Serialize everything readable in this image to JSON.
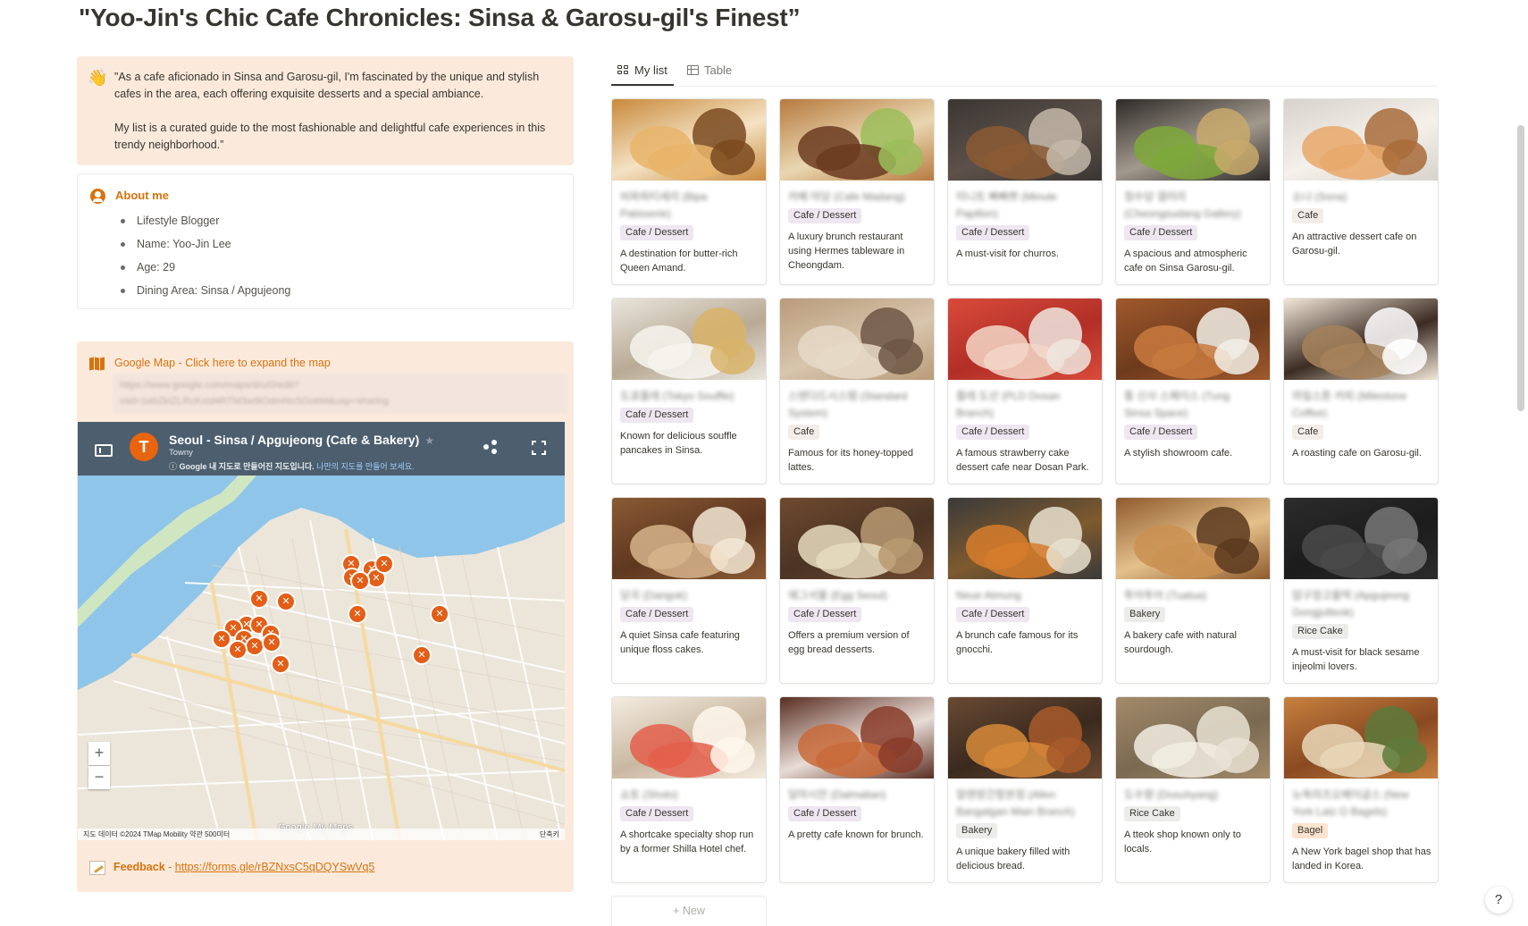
{
  "title": "\"Yoo-Jin's Chic Cafe Chronicles: Sinsa & Garosu-gil's Finest”",
  "intro": {
    "icon": "waving-hand-icon",
    "paragraph1": "\"As a cafe aficionado in Sinsa and Garosu-gil, I'm fascinated by the unique and stylish cafes in the area, each offering exquisite desserts and a special ambiance.",
    "paragraph2": "My list is a curated guide to the most fashionable and delightful cafe experiences in this trendy neighborhood.”"
  },
  "about": {
    "icon": "person-icon",
    "heading": "About me",
    "items": [
      "Lifestyle Blogger",
      "Name: Yoo-Jin Lee",
      "Age: 29",
      "Dining Area: Sinsa / Apgujeong"
    ]
  },
  "map_callout": {
    "icon": "map-icon",
    "heading": "Google Map - Click here to expand the map",
    "blurred_link": "https://www.google.com/maps/d/u/0/edit?mid=1ebZkIZLRzKxId4RTM3w9tOdmNxSGo6M&usp=sharing",
    "embed": {
      "title": "Seoul - Sinsa / Apgujeong (Cafe & Bakery)",
      "subtitle": "Towny",
      "notice": "Google 내 지도로 만들어진 지도입니다.",
      "notice_link": "나만의 지도를 만들어 보세요.",
      "logo_letter": "T",
      "google_logo": "Google",
      "my_maps": "My Maps",
      "attribution": "지도 데이터 ©2024 TMap Mobility   약관   500미터",
      "shortcut": "단축키",
      "zoom_in": "+",
      "zoom_out": "−"
    }
  },
  "feedback": {
    "icon": "memo-icon",
    "label": "Feedback",
    "separator": " - ",
    "link": "https://forms.gle/rBZNxsC5qDQYSwVq5"
  },
  "tabs": [
    {
      "label": "My list",
      "icon": "gallery-icon",
      "active": true
    },
    {
      "label": "Table",
      "icon": "table-icon",
      "active": false
    }
  ],
  "cards": [
    {
      "name": "비파파티세리 (Bipa Patisserie)",
      "tag": "Cafe / Dessert",
      "tag_color": "purple",
      "desc": "A destination for butter-rich Queen Amand."
    },
    {
      "name": "카페 마당 (Cafe Madang)",
      "tag": "Cafe / Dessert",
      "tag_color": "purple",
      "desc": "A luxury brunch restaurant using Hermes tableware in Cheongdam."
    },
    {
      "name": "미니트 빠빠쁘 (Minute Papillon)",
      "tag": "Cafe / Dessert",
      "tag_color": "purple",
      "desc": "A must-visit for churros."
    },
    {
      "name": "청수당 갤러리 (Cheongsudang Gallery)",
      "tag": "Cafe / Dessert",
      "tag_color": "purple",
      "desc": "A spacious and atmospheric cafe on Sinsa Garosu-gil."
    },
    {
      "name": "소나 (Sona)",
      "tag": "Cafe",
      "tag_color": "brown",
      "desc": "An attractive dessert cafe on Garosu-gil."
    },
    {
      "name": "도쿄플레 (Tokyo Souffle)",
      "tag": "Cafe / Dessert",
      "tag_color": "purple",
      "desc": "Known for delicious souffle pancakes in Sinsa."
    },
    {
      "name": "스탠다드시스템 (Standard System)",
      "tag": "Cafe",
      "tag_color": "brown",
      "desc": "Famous for its honey-topped lattes."
    },
    {
      "name": "플레 도산 (PLD Dosan Branch)",
      "tag": "Cafe / Dessert",
      "tag_color": "purple",
      "desc": "A famous strawberry cake dessert cafe near Dosan Park."
    },
    {
      "name": "퉁 신사 스페이스 (Tung Sinsa Space)",
      "tag": "Cafe / Dessert",
      "tag_color": "purple",
      "desc": "A stylish showroom cafe."
    },
    {
      "name": "마일스톤 커피 (Milestone Coffee)",
      "tag": "Cafe",
      "tag_color": "brown",
      "desc": "A roasting cafe on Garosu-gil."
    },
    {
      "name": "당곡 (Dangok)",
      "tag": "Cafe / Dessert",
      "tag_color": "purple",
      "desc": "A quiet Sinsa cafe featuring unique floss cakes."
    },
    {
      "name": "에그서울 (Egg Seoul)",
      "tag": "Cafe / Dessert",
      "tag_color": "purple",
      "desc": "Offers a premium version of egg bread desserts."
    },
    {
      "name": "Neue Atmung",
      "tag": "Cafe / Dessert",
      "tag_color": "purple",
      "desc": "A brunch cafe famous for its gnocchi."
    },
    {
      "name": "투아투아 (Tuatua)",
      "tag": "Bakery",
      "tag_color": "gray",
      "desc": "A bakery cafe with natural sourdough."
    },
    {
      "name": "압구정고물떡 (Apgujeong Gongjutteok)",
      "tag": "Rice Cake",
      "tag_color": "gray",
      "desc": "A must-visit for black sesame injeolmi lovers."
    },
    {
      "name": "쇼토 (Shoto)",
      "tag": "Cafe / Dessert",
      "tag_color": "purple",
      "desc": "A shortcake specialty shop run by a former Shilla Hotel chef."
    },
    {
      "name": "달마시안 (Dalmatian)",
      "tag": "Cafe / Dessert",
      "tag_color": "purple",
      "desc": "A pretty cafe known for brunch."
    },
    {
      "name": "알렌방간항본점 (Allen Bangatgan Main Branch)",
      "tag": "Bakery",
      "tag_color": "gray",
      "desc": "A unique bakery filled with delicious bread."
    },
    {
      "name": "도수향 (Dosuhyang)",
      "tag": "Rice Cake",
      "tag_color": "gray",
      "desc": "A tteok shop known only to locals."
    },
    {
      "name": "뉴욕라츠오베이글스 (New York Latz O Bagels)",
      "tag": "Bagel",
      "tag_color": "orange",
      "desc": "A New York bagel shop that has landed in Korea."
    }
  ],
  "new_button": "+ New",
  "help_button": "?"
}
